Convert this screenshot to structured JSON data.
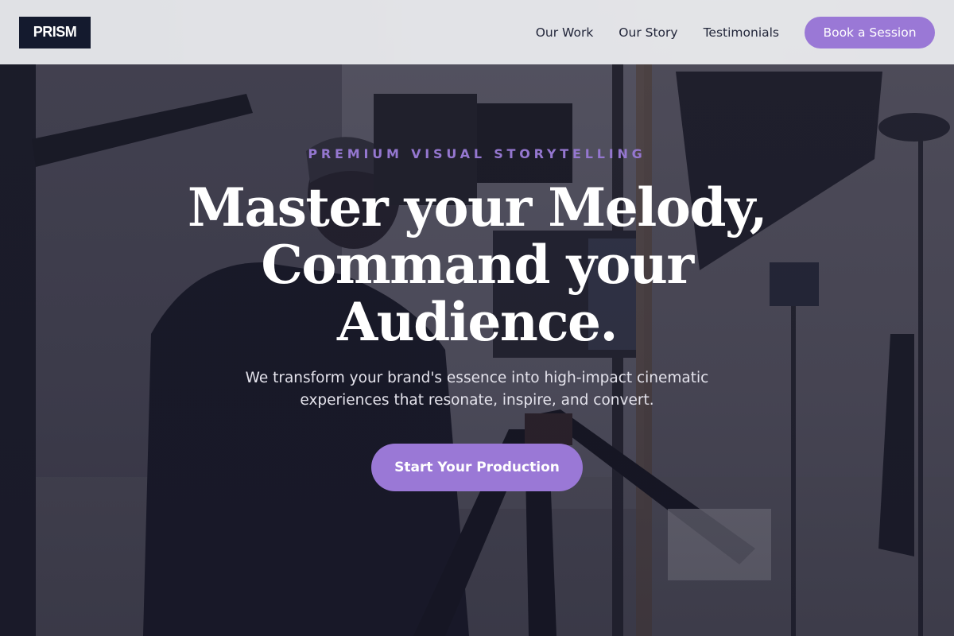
{
  "brand": {
    "logo_text": "PRISM"
  },
  "nav": {
    "links": [
      "Our Work",
      "Our Story",
      "Testimonials"
    ],
    "cta_label": "Book a Session"
  },
  "hero": {
    "eyebrow": "PREMIUM VISUAL STORYTELLING",
    "headline": "Master your Melody, Command your Audience.",
    "subheadline": "We transform your brand's essence into high-impact cinematic experiences that resonate, inspire, and convert.",
    "cta_label": "Start Your Production",
    "background_image": "videographer-with-camera-on-tripod"
  },
  "colors": {
    "accent": "#9a78d6",
    "eyebrow": "#9577d0",
    "logo_bg": "#141a2e",
    "nav_bg": "#ecedf0",
    "text_dark": "#22263a"
  }
}
